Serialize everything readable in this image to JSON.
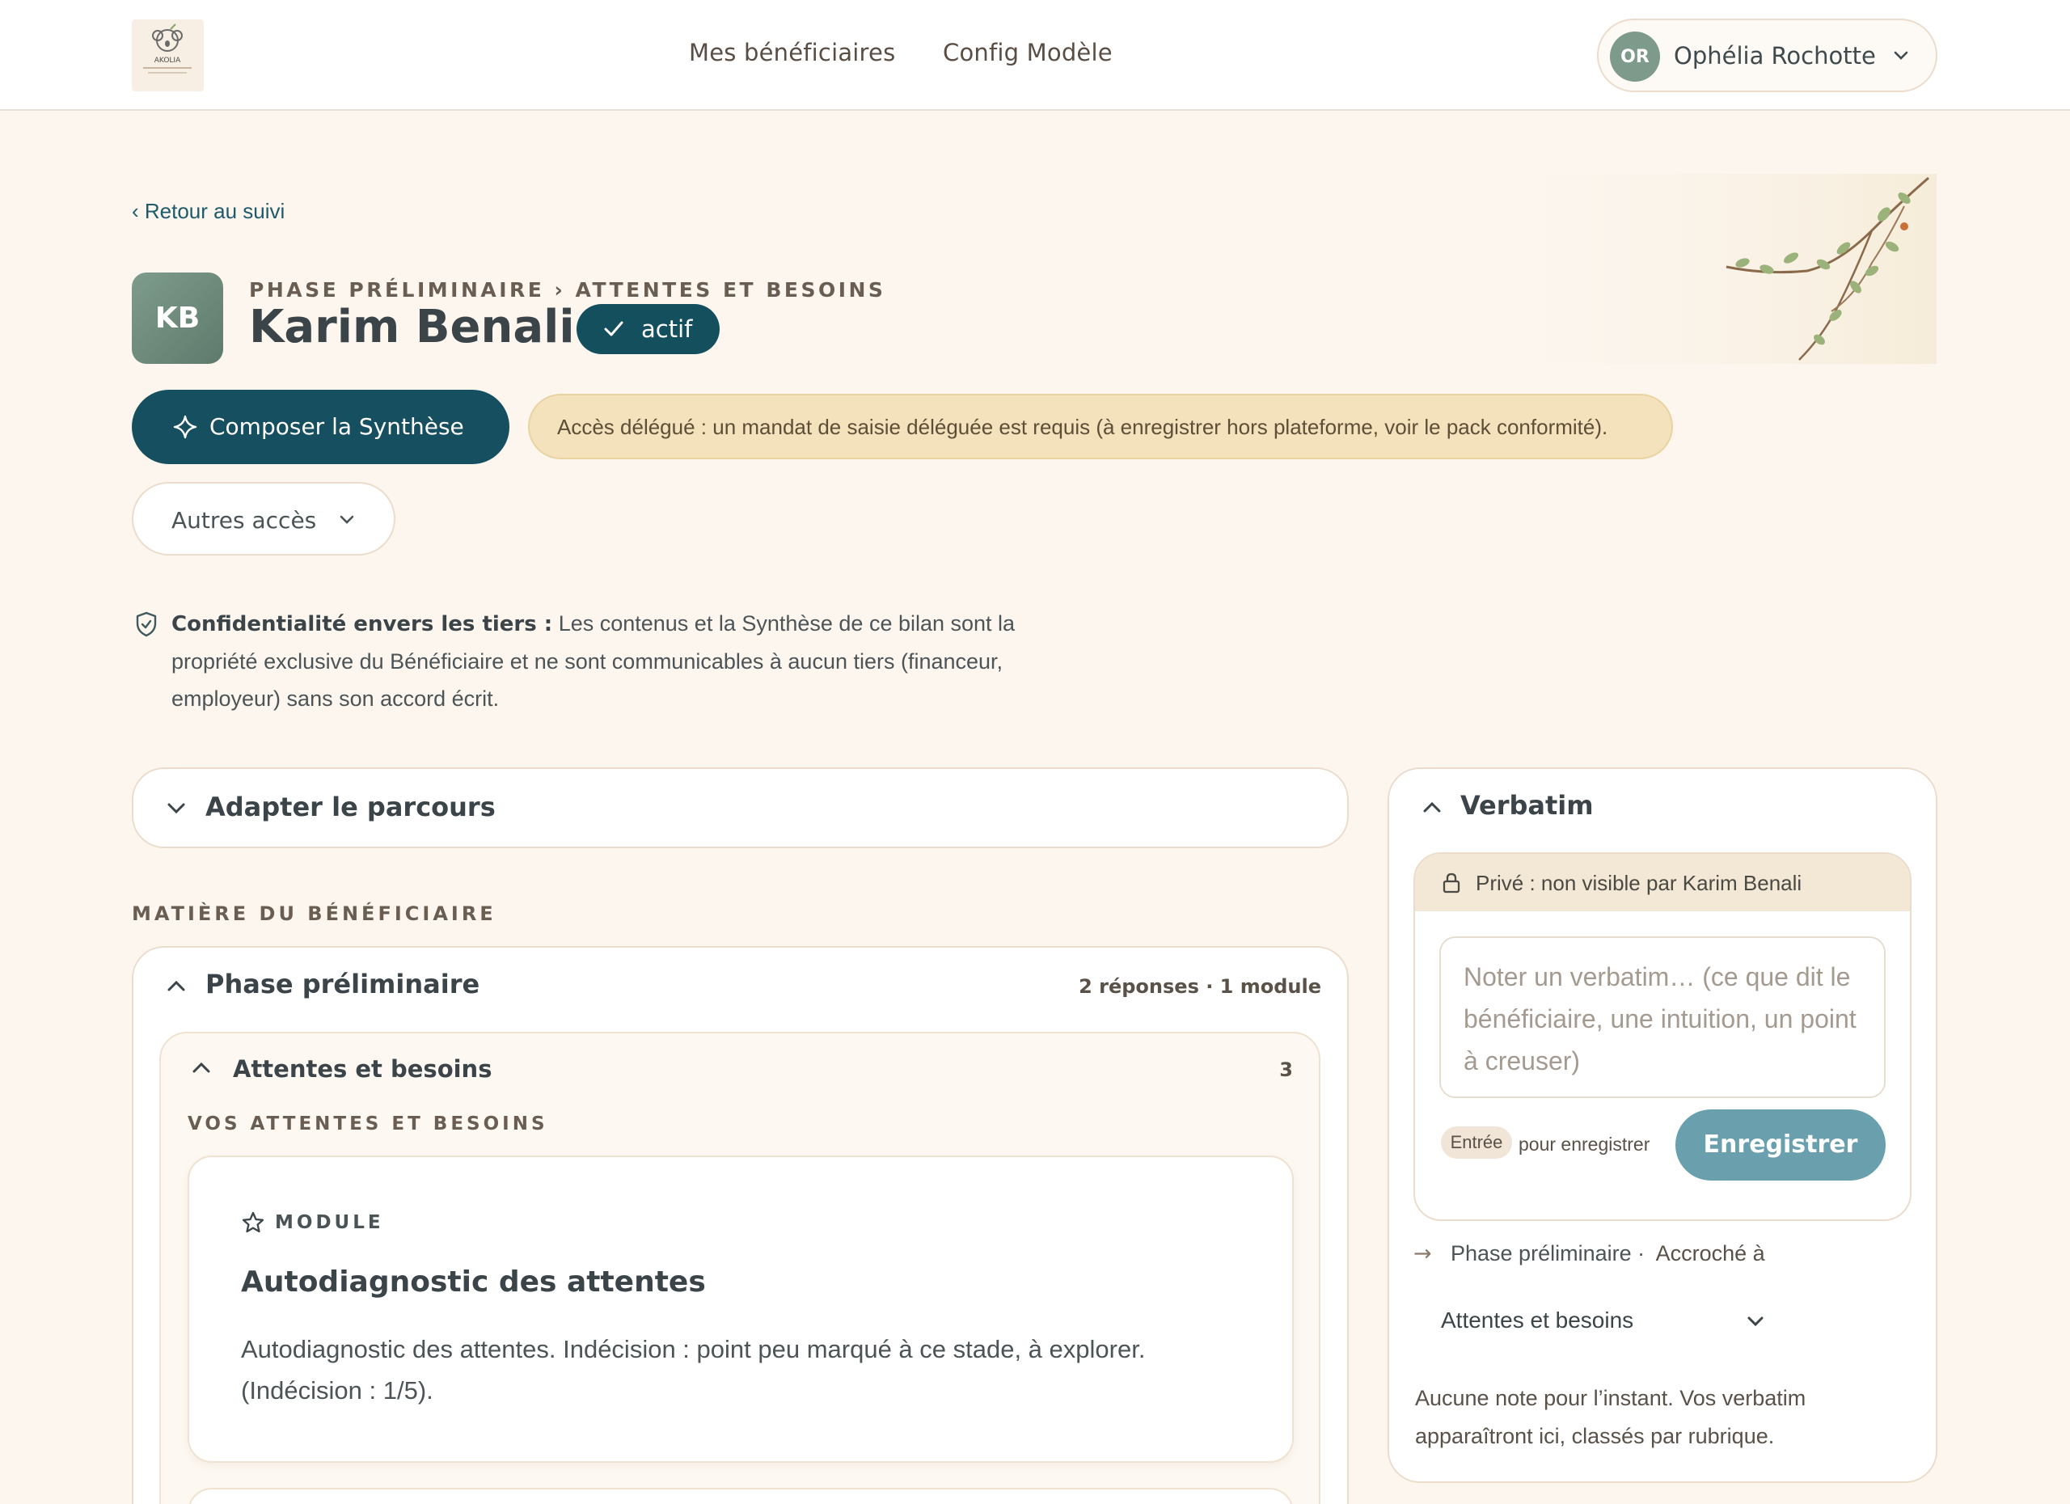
{
  "header": {
    "logo_text": "AKOLIA",
    "nav": [
      "Mes bénéficiaires",
      "Config Modèle"
    ],
    "user": {
      "initials": "OR",
      "name": "Ophélia Rochotte"
    }
  },
  "page": {
    "back_link": "‹ Retour au suivi",
    "breadcrumb": "PHASE PRÉLIMINAIRE  ›  ATTENTES ET BESOINS",
    "avatar_initials": "KB",
    "name": "Karim Benali",
    "status": "actif",
    "primary_action": "Composer la Synthèse",
    "notice": "Accès délégué : un mandat de saisie déléguée est requis (à enregistrer hors plateforme, voir le pack conformité).",
    "other_access": "Autres accès",
    "confidentiality_title": "Confidentialité envers les tiers :",
    "confidentiality_text": " Les contenus et la Synthèse de ce bilan sont la propriété exclusive du Bénéficiaire et ne sont communicables à aucun tiers (financeur, employeur) sans son accord écrit."
  },
  "main": {
    "adapt_title": "Adapter le parcours",
    "section_label": "MATIÈRE DU BÉNÉFICIAIRE",
    "phase": {
      "title": "Phase préliminaire",
      "meta": "2 réponses · 1 module"
    },
    "rubric": {
      "title": "Attentes et besoins",
      "count": "3",
      "label": "VOS ATTENTES ET BESOINS"
    },
    "module": {
      "kind": "MODULE",
      "title": "Autodiagnostic des attentes",
      "text": "Autodiagnostic des attentes. Indécision : point peu marqué à ce stade, à explorer. (Indécision : 1/5)."
    }
  },
  "verbatim": {
    "title": "Verbatim",
    "private_notice": "Privé : non visible par Karim Benali",
    "placeholder": "Noter un verbatim… (ce que dit le bénéficiaire, une intuition, un point à creuser)",
    "kbd": "Entrée",
    "kbd_hint": "pour enregistrer",
    "save": "Enregistrer",
    "attach_prefix": "Phase préliminaire ·",
    "attach_label": "Accroché à",
    "attach_value": "Attentes et besoins",
    "empty": "Aucune note pour l’instant. Vos verbatim apparaîtront ici, classés par rubrique."
  },
  "colors": {
    "accent": "#164f5f",
    "background": "#fcf6ef",
    "notice": "#f4e2bd",
    "save": "#6aa0ad"
  }
}
